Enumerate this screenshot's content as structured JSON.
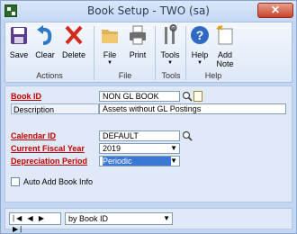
{
  "window": {
    "title": "Book Setup  -  TWO (sa)",
    "close_glyph": "✕"
  },
  "ribbon": {
    "actions": [
      {
        "label": "Save",
        "icon": "save-icon"
      },
      {
        "label": "Clear",
        "icon": "clear-icon"
      },
      {
        "label": "Delete",
        "icon": "delete-icon"
      }
    ],
    "actions_group": "Actions",
    "file_buttons": [
      {
        "label": "File",
        "icon": "folder-icon"
      },
      {
        "label": "Print",
        "icon": "printer-icon"
      }
    ],
    "file_group": "File",
    "tools_button": {
      "label": "Tools",
      "icon": "tools-icon"
    },
    "tools_group": "Tools",
    "help_buttons": [
      {
        "label": "Help",
        "icon": "help-icon"
      },
      {
        "label": "Add Note",
        "icon": "add-note-icon"
      }
    ],
    "help_group": "Help",
    "dropdown_glyph": "▼"
  },
  "form": {
    "book_id_label": "Book ID",
    "book_id_value": "NON GL BOOK",
    "description_label": "Description",
    "description_value": "Assets without GL Postings",
    "calendar_id_label": "Calendar ID",
    "calendar_id_value": "DEFAULT",
    "fiscal_year_label": "Current Fiscal Year",
    "fiscal_year_value": "2019",
    "depreciation_label": "Depreciation Period",
    "depreciation_value": "Periodic",
    "auto_add_label": "Auto Add Book Info"
  },
  "bottom": {
    "nav_glyphs": "|◀ ◀ ▶ ▶|",
    "sort_value": "by Book ID",
    "dropdown_glyph": "▼"
  },
  "colors": {
    "required_label": "#c00000",
    "selection": "#3a78d6",
    "close_button": "#c7432c"
  }
}
